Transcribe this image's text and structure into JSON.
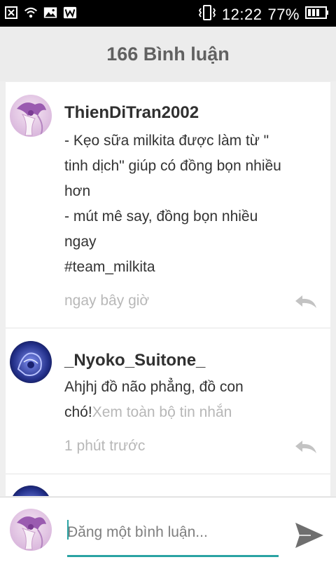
{
  "statusbar": {
    "time": "12:22",
    "battery_percent": "77%",
    "icons": [
      "close-box-icon",
      "wifi-icon",
      "image-icon",
      "w-app-icon",
      "vibrate-icon",
      "battery-icon"
    ]
  },
  "header": {
    "title": "166 Bình luận"
  },
  "comments": [
    {
      "username": "ThienDiTran2002",
      "lines": [
        "- Kẹo sữa milkita được làm từ \"",
        "tinh dịch\" giúp có đồng bọn nhiều",
        "hơn",
        "- mút mê say, đồng bọn nhiều",
        "ngay",
        "#team_milkita"
      ],
      "time": "ngay bây giờ"
    },
    {
      "username": "_Nyoko_Suitone_",
      "line1": "Ahjhj đồ não phẳng, đồ con",
      "line2_start": "chó!",
      "see_more": "Xem toàn bộ tin nhắn",
      "time": "1 phút trước"
    }
  ],
  "composer": {
    "placeholder": "Đăng một bình luận..."
  },
  "colors": {
    "accent": "#2aa3a3",
    "statusbar": "#000000",
    "header_bg": "#ececec"
  }
}
